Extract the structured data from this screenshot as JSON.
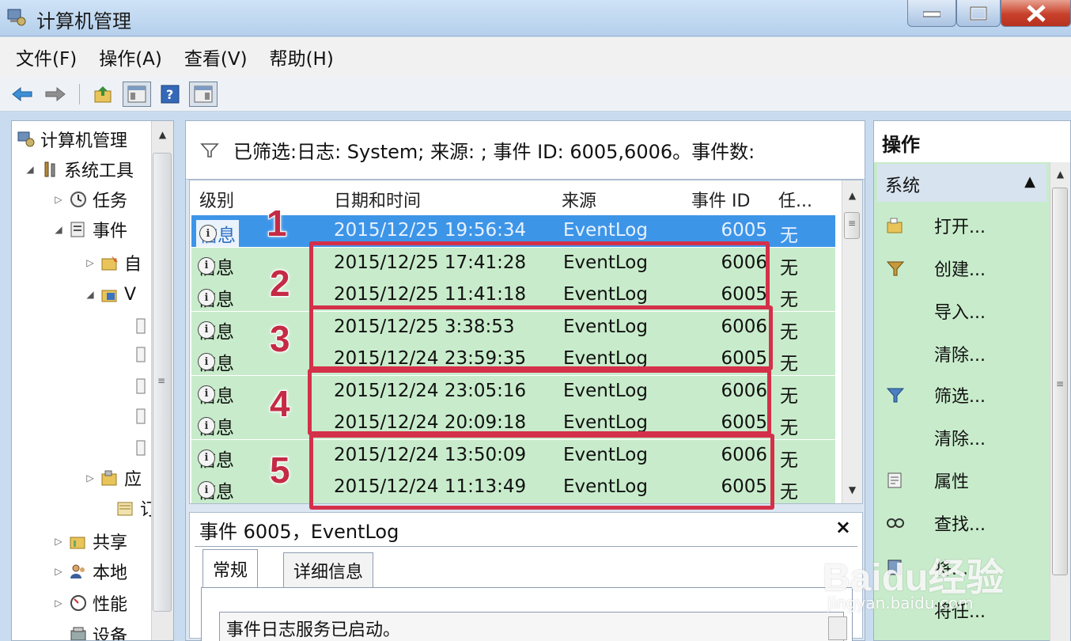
{
  "window": {
    "title": "计算机管理"
  },
  "menu": [
    "文件(F)",
    "操作(A)",
    "查看(V)",
    "帮助(H)"
  ],
  "toolbar": [
    "back-icon",
    "forward-icon",
    "up-folder-icon",
    "show-hide-console-tree-icon",
    "help-icon",
    "show-hide-action-pane-icon"
  ],
  "tree": {
    "items": [
      {
        "label": "计算机管理",
        "icon": "computer-management-icon",
        "level": 0,
        "expander": ""
      },
      {
        "label": "系统工具",
        "icon": "tools-icon",
        "level": 1,
        "expander": "◢"
      },
      {
        "label": "任务",
        "icon": "task-scheduler-icon",
        "level": 2,
        "expander": "▷"
      },
      {
        "label": "事件",
        "icon": "event-viewer-icon",
        "level": 2,
        "expander": "◢"
      },
      {
        "label": "自",
        "icon": "custom-views-icon",
        "level": 3,
        "expander": "▷"
      },
      {
        "label": "V",
        "icon": "windows-logs-icon",
        "level": 3,
        "expander": "◢"
      },
      {
        "label": "",
        "icon": "log-icon",
        "level": 4,
        "expander": ""
      },
      {
        "label": "",
        "icon": "log-icon",
        "level": 4,
        "expander": ""
      },
      {
        "label": "",
        "icon": "log-icon",
        "level": 4,
        "expander": ""
      },
      {
        "label": "",
        "icon": "log-icon",
        "level": 4,
        "expander": ""
      },
      {
        "label": "",
        "icon": "log-icon",
        "level": 4,
        "expander": ""
      },
      {
        "label": "应",
        "icon": "app-logs-icon",
        "level": 3,
        "expander": "▷"
      },
      {
        "label": "订",
        "icon": "subscriptions-icon",
        "level": 3,
        "expander": ""
      },
      {
        "label": "共享",
        "icon": "shared-folders-icon",
        "level": 2,
        "expander": "▷"
      },
      {
        "label": "本地",
        "icon": "local-users-icon",
        "level": 2,
        "expander": "▷"
      },
      {
        "label": "性能",
        "icon": "performance-icon",
        "level": 2,
        "expander": "▷"
      },
      {
        "label": "设备",
        "icon": "device-manager-icon",
        "level": 2,
        "expander": ""
      }
    ]
  },
  "filter": {
    "text": "已筛选:日志: System; 来源: ; 事件 ID: 6005,6006。事件数:"
  },
  "grid": {
    "columns": [
      "级别",
      "日期和时间",
      "来源",
      "事件 ID",
      "任..."
    ],
    "rows": [
      {
        "level": "信息",
        "datetime": "2015/12/25 19:56:34",
        "source": "EventLog",
        "event_id": "6005",
        "task": "无",
        "selected": true
      },
      {
        "level": "信息",
        "datetime": "2015/12/25 17:41:28",
        "source": "EventLog",
        "event_id": "6006",
        "task": "无",
        "selected": false
      },
      {
        "level": "信息",
        "datetime": "2015/12/25 11:41:18",
        "source": "EventLog",
        "event_id": "6005",
        "task": "无",
        "selected": false
      },
      {
        "level": "信息",
        "datetime": "2015/12/25 3:38:53",
        "source": "EventLog",
        "event_id": "6006",
        "task": "无",
        "selected": false
      },
      {
        "level": "信息",
        "datetime": "2015/12/24 23:59:35",
        "source": "EventLog",
        "event_id": "6005",
        "task": "无",
        "selected": false
      },
      {
        "level": "信息",
        "datetime": "2015/12/24 23:05:16",
        "source": "EventLog",
        "event_id": "6006",
        "task": "无",
        "selected": false
      },
      {
        "level": "信息",
        "datetime": "2015/12/24 20:09:18",
        "source": "EventLog",
        "event_id": "6005",
        "task": "无",
        "selected": false
      },
      {
        "level": "信息",
        "datetime": "2015/12/24 13:50:09",
        "source": "EventLog",
        "event_id": "6006",
        "task": "无",
        "selected": false
      },
      {
        "level": "信息",
        "datetime": "2015/12/24 11:13:49",
        "source": "EventLog",
        "event_id": "6005",
        "task": "无",
        "selected": false
      }
    ]
  },
  "annotations": [
    "1",
    "2",
    "3",
    "4",
    "5"
  ],
  "details": {
    "title": "事件 6005，EventLog",
    "close": "×",
    "tabs": [
      "常规",
      "详细信息"
    ],
    "message": "事件日志服务已启动。"
  },
  "actions": {
    "header": "操作",
    "group": "系统",
    "items": [
      {
        "label": "打开...",
        "icon": "open-log-icon"
      },
      {
        "label": "创建...",
        "icon": "create-view-icon"
      },
      {
        "label": "导入...",
        "icon": ""
      },
      {
        "label": "清除...",
        "icon": ""
      },
      {
        "label": "筛选...",
        "icon": "filter-icon"
      },
      {
        "label": "清除...",
        "icon": ""
      },
      {
        "label": "属性",
        "icon": "properties-icon"
      },
      {
        "label": "查找...",
        "icon": "find-icon"
      },
      {
        "label": "将...",
        "icon": "save-icon"
      },
      {
        "label": "将任...",
        "icon": ""
      }
    ]
  },
  "watermark": {
    "logo": "Baidu经验",
    "url": "jingyan.baidu.com"
  },
  "colors": {
    "selected_row": "#3d95e8",
    "row_highlight": "#c8eccb",
    "annotation_red": "#d4304a"
  }
}
